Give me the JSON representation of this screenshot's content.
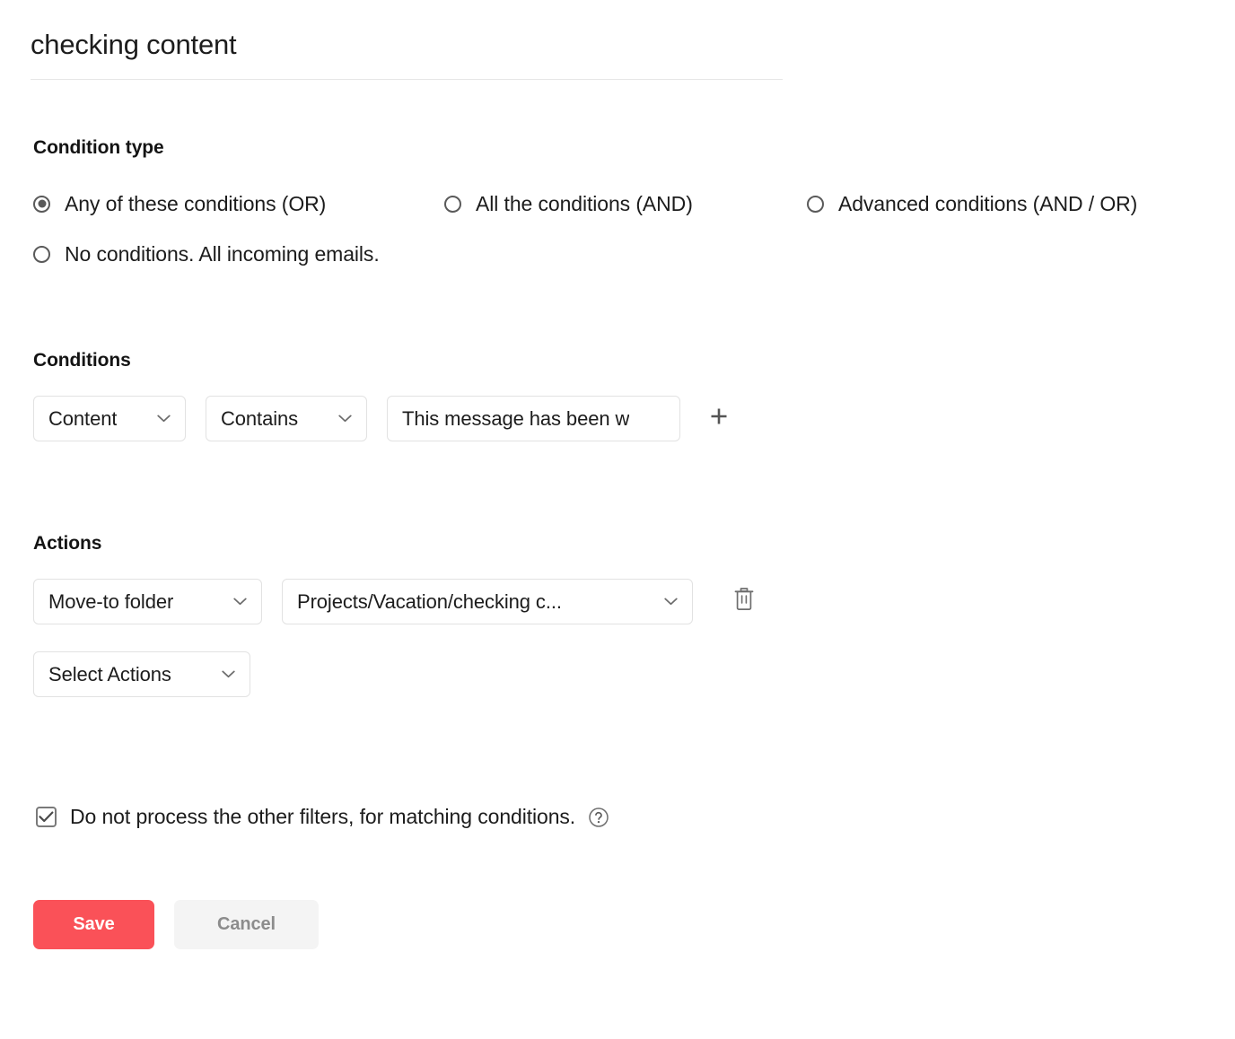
{
  "header": {
    "title": "checking content"
  },
  "condition_type": {
    "heading": "Condition type",
    "options": [
      {
        "label": "Any of these conditions (OR)",
        "selected": true
      },
      {
        "label": "All the conditions (AND)",
        "selected": false
      },
      {
        "label": "Advanced conditions (AND / OR)",
        "selected": false
      },
      {
        "label": "No conditions. All incoming emails.",
        "selected": false
      }
    ]
  },
  "conditions": {
    "heading": "Conditions",
    "field_label": "Content",
    "operator_label": "Contains",
    "value": "This message has been w",
    "add_icon": "plus-icon"
  },
  "actions": {
    "heading": "Actions",
    "action_label": "Move-to folder",
    "target_label": "Projects/Vacation/checking c...",
    "delete_icon": "trash-icon",
    "select_actions_label": "Select Actions"
  },
  "options_row": {
    "checkbox_label": "Do not process the other filters, for matching conditions.",
    "checked": true,
    "help_icon": "question-circle-icon"
  },
  "footer": {
    "save_label": "Save",
    "cancel_label": "Cancel",
    "save_color": "#fa5158",
    "cancel_bg": "#f4f4f4"
  }
}
